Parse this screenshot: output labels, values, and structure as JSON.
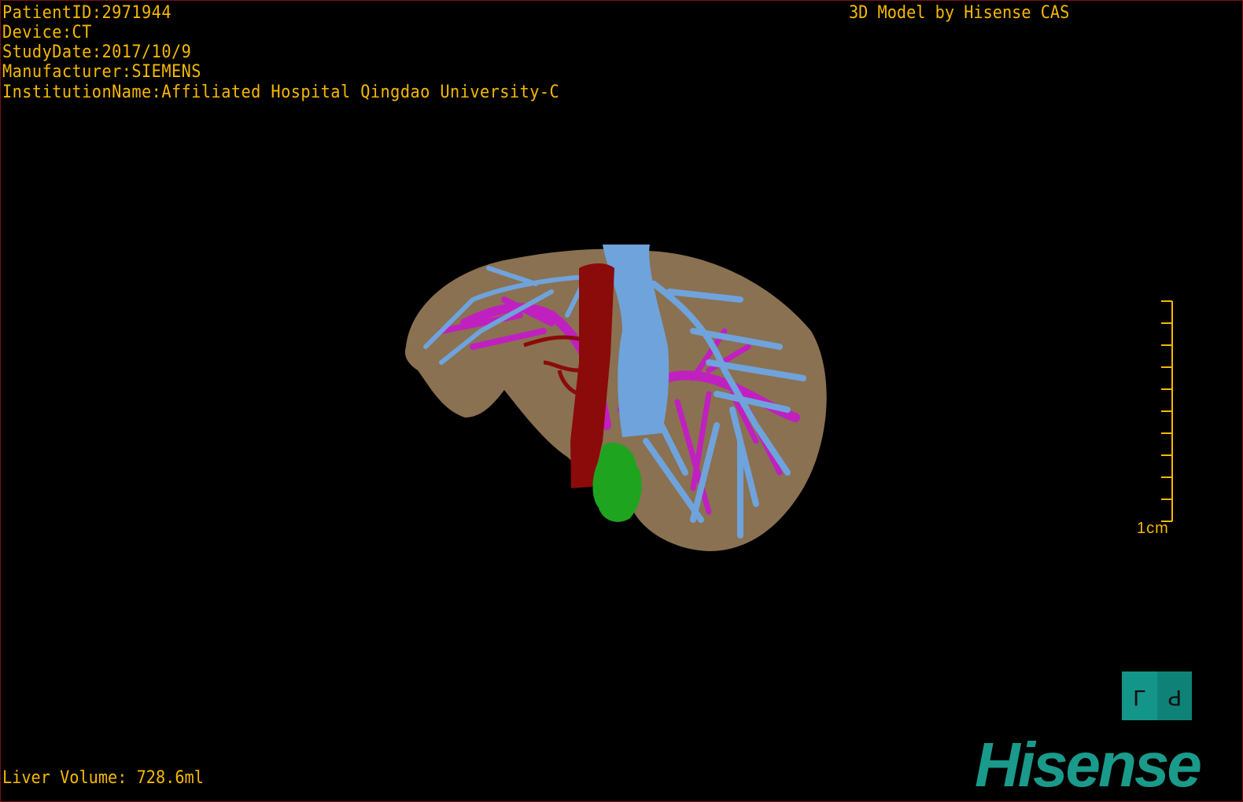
{
  "patient_info": {
    "patient_id": "PatientID:2971944",
    "device": "Device:CT",
    "study_date": "StudyDate:2017/10/9",
    "manufacturer": "Manufacturer:SIEMENS",
    "institution": "InstitutionName:Affiliated Hospital Qingdao University-C"
  },
  "credit": "3D Model by Hisense CAS",
  "liver_volume": "Liver Volume: 728.6ml",
  "scale_bar": {
    "label": "1cm",
    "divisions": 10
  },
  "orientation_cube": {
    "left_face": "L",
    "right_face": "P",
    "color": "#14958a"
  },
  "logo": "Hisense",
  "colors": {
    "overlay_text": "#f5b800",
    "liver": "#8a7152",
    "hepatic_vein": "#6fa3dc",
    "portal_vein": "#c020c0",
    "artery": "#8b0a0a",
    "lesion": "#1fa41f",
    "logo": "#1a9a8a"
  }
}
